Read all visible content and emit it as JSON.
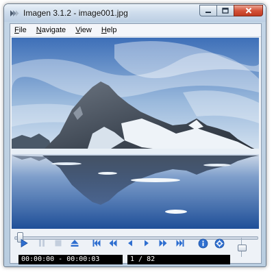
{
  "window": {
    "title": "Imagen 3.1.2 - image001.jpg",
    "app_icon": "imagen-app-icon",
    "caption_buttons": [
      "minimize-icon",
      "maximize-icon",
      "close-icon"
    ]
  },
  "menu": {
    "items": [
      {
        "label": "File",
        "accel": "F"
      },
      {
        "label": "Navigate",
        "accel": "N"
      },
      {
        "label": "View",
        "accel": "V"
      },
      {
        "label": "Help",
        "accel": "H"
      }
    ]
  },
  "viewer": {
    "content": "photo-mountain-lake-reflection"
  },
  "playback": {
    "seek_position": 0.0,
    "controls": [
      {
        "name": "play-icon",
        "enabled": true
      },
      {
        "name": "pause-icon",
        "enabled": false
      },
      {
        "name": "stop-icon",
        "enabled": false
      },
      {
        "name": "eject-icon",
        "enabled": true
      },
      {
        "name": "first-image-icon",
        "enabled": true
      },
      {
        "name": "rewind-icon",
        "enabled": true
      },
      {
        "name": "previous-icon",
        "enabled": true
      },
      {
        "name": "next-icon",
        "enabled": true
      },
      {
        "name": "fast-forward-icon",
        "enabled": true
      },
      {
        "name": "last-image-icon",
        "enabled": true
      },
      {
        "name": "info-icon",
        "enabled": true
      },
      {
        "name": "settings-icon",
        "enabled": true
      }
    ],
    "volume": 0.5
  },
  "status": {
    "time": "00:00:00 - 00:00:03",
    "position": "1 / 82"
  },
  "colors": {
    "accent_blue": "#2f6fd0",
    "status_bg": "#000000",
    "status_fg": "#ffffff",
    "close_red": "#c8452c"
  }
}
